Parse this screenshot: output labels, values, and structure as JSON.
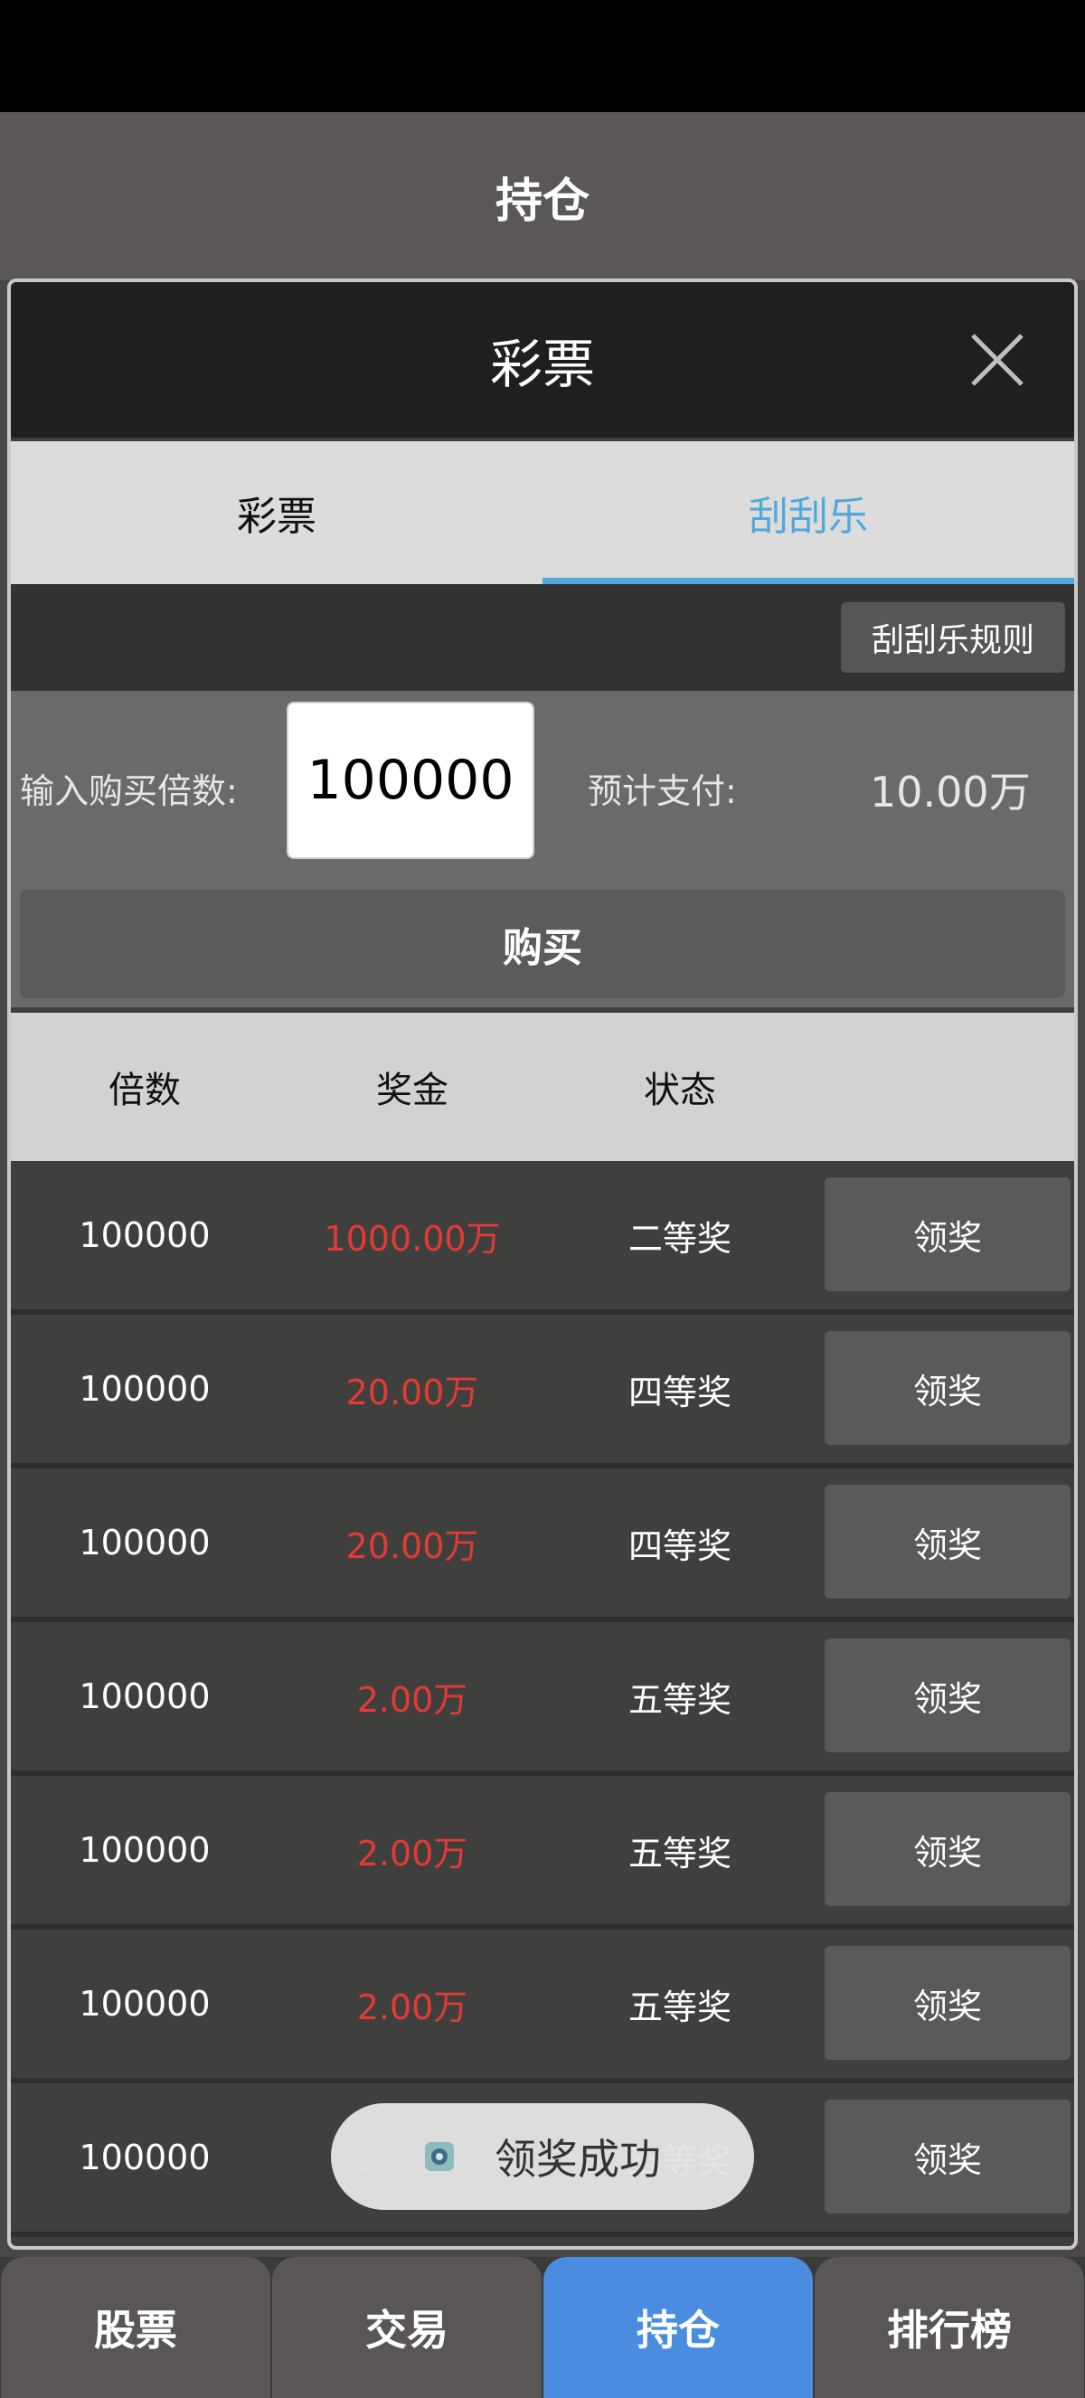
{
  "header": {
    "title": "持仓"
  },
  "dialog": {
    "title": "彩票",
    "tabs": [
      {
        "label": "彩票",
        "active": false
      },
      {
        "label": "刮刮乐",
        "active": true
      }
    ],
    "rules_button": "刮刮乐规则",
    "buy": {
      "multiplier_label": "输入购买倍数:",
      "multiplier_value": "100000",
      "payment_label": "预计支付:",
      "payment_value": "10.00万",
      "buy_button": "购买"
    },
    "table": {
      "columns": [
        "倍数",
        "奖金",
        "状态"
      ],
      "rows": [
        {
          "multiplier": "100000",
          "prize": "1000.00万",
          "status": "二等奖",
          "action": "领奖"
        },
        {
          "multiplier": "100000",
          "prize": "20.00万",
          "status": "四等奖",
          "action": "领奖"
        },
        {
          "multiplier": "100000",
          "prize": "20.00万",
          "status": "四等奖",
          "action": "领奖"
        },
        {
          "multiplier": "100000",
          "prize": "2.00万",
          "status": "五等奖",
          "action": "领奖"
        },
        {
          "multiplier": "100000",
          "prize": "2.00万",
          "status": "五等奖",
          "action": "领奖"
        },
        {
          "multiplier": "100000",
          "prize": "2.00万",
          "status": "五等奖",
          "action": "领奖"
        },
        {
          "multiplier": "100000",
          "prize": "2.00万",
          "status": "五等奖",
          "action": "领奖"
        }
      ]
    }
  },
  "toast": {
    "text": "领奖成功",
    "icon": "app-icon"
  },
  "bottom_nav": [
    {
      "label": "股票",
      "active": false
    },
    {
      "label": "交易",
      "active": false
    },
    {
      "label": "持仓",
      "active": true
    },
    {
      "label": "排行榜",
      "active": false
    }
  ],
  "colors": {
    "accent_tab": "#52a8d9",
    "prize_red": "#e53a33",
    "nav_active": "#4a8ce0"
  }
}
